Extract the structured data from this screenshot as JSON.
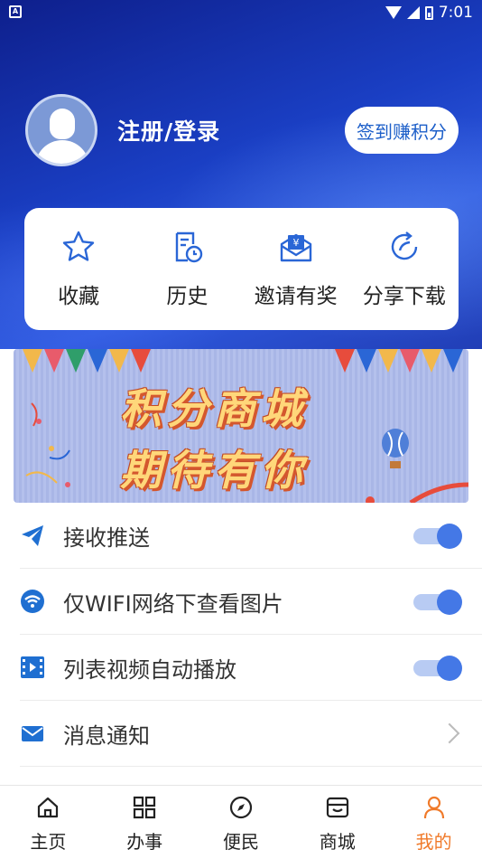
{
  "status_bar": {
    "time": "7:01"
  },
  "profile": {
    "login_text": "注册/登录",
    "signin_button": "签到赚积分"
  },
  "quick_actions": [
    {
      "label": "收藏",
      "icon": "star-icon"
    },
    {
      "label": "历史",
      "icon": "history-icon"
    },
    {
      "label": "邀请有奖",
      "icon": "invite-icon"
    },
    {
      "label": "分享下载",
      "icon": "share-icon"
    }
  ],
  "banner": {
    "line1": "积分商城",
    "line2": "期待有你"
  },
  "settings": [
    {
      "label": "接收推送",
      "icon": "send-icon",
      "control": "toggle",
      "enabled": true
    },
    {
      "label": "仅WIFI网络下查看图片",
      "icon": "wifi-icon",
      "control": "toggle",
      "enabled": true
    },
    {
      "label": "列表视频自动播放",
      "icon": "video-icon",
      "control": "toggle",
      "enabled": true
    },
    {
      "label": "消息通知",
      "icon": "mail-icon",
      "control": "chevron"
    }
  ],
  "tabbar": [
    {
      "label": "主页",
      "icon": "home-icon",
      "active": false
    },
    {
      "label": "办事",
      "icon": "grid-icon",
      "active": false
    },
    {
      "label": "便民",
      "icon": "compass-icon",
      "active": false
    },
    {
      "label": "商城",
      "icon": "store-icon",
      "active": false
    },
    {
      "label": "我的",
      "icon": "user-icon",
      "active": true
    }
  ],
  "colors": {
    "primary": "#1d5fc9",
    "active_tab": "#f07a2a",
    "toggle_on": "#4478e6"
  }
}
